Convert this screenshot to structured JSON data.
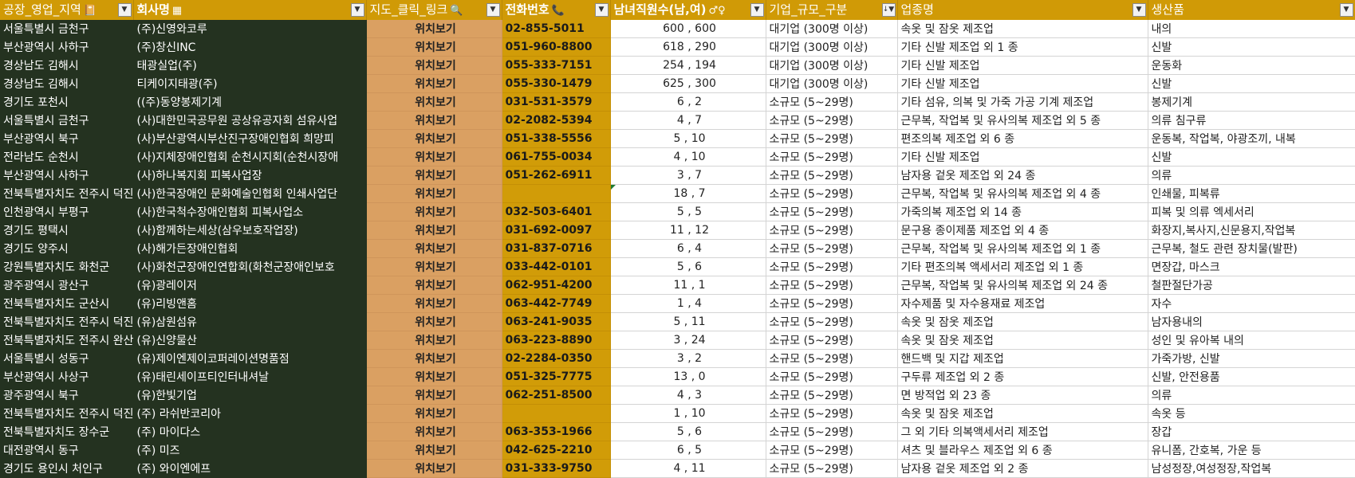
{
  "headers": [
    {
      "label": "공장_영업_지역",
      "icon": "📔",
      "icon_name": "notebook-icon",
      "bold": false
    },
    {
      "label": "회사명",
      "icon": "▦",
      "icon_name": "building-icon",
      "bold": true
    },
    {
      "label": "지도_클릭_링크",
      "icon": "🔍",
      "icon_name": "search-icon",
      "bold": false
    },
    {
      "label": "전화번호",
      "icon": "📞",
      "icon_name": "phone-icon",
      "bold": true
    },
    {
      "label": "남녀직원수(남,여)",
      "icon": "♂♀",
      "icon_name": "gender-icon",
      "bold": true
    },
    {
      "label": "기업_규모_구분",
      "icon": "",
      "icon_name": "",
      "bold": false
    },
    {
      "label": "업종명",
      "icon": "",
      "icon_name": "",
      "bold": false
    },
    {
      "label": "생산품",
      "icon": "",
      "icon_name": "",
      "bold": false
    }
  ],
  "filter_glyph": "▼",
  "sorted_filter_glyph": "↓▼",
  "rows": [
    {
      "region": "서울특별시 금천구",
      "company": "(주)신영와코루",
      "map": "위치보기",
      "phone": "02-855-5011",
      "staff": "600 , 600",
      "scale": "대기업 (300명 이상)",
      "industry": "속옷 및 잠옷 제조업",
      "products": "내의"
    },
    {
      "region": "부산광역시 사하구",
      "company": "(주)창신INC",
      "map": "위치보기",
      "phone": "051-960-8800",
      "staff": "618 , 290",
      "scale": "대기업 (300명 이상)",
      "industry": "기타 신발 제조업 외 1 종",
      "products": "신발"
    },
    {
      "region": "경상남도 김해시",
      "company": "태광실업(주)",
      "map": "위치보기",
      "phone": "055-333-7151",
      "staff": "254 , 194",
      "scale": "대기업 (300명 이상)",
      "industry": "기타 신발 제조업",
      "products": "운동화"
    },
    {
      "region": "경상남도 김해시",
      "company": "티케이지태광(주)",
      "map": "위치보기",
      "phone": "055-330-1479",
      "staff": "625 , 300",
      "scale": "대기업 (300명 이상)",
      "industry": "기타 신발 제조업",
      "products": "신발"
    },
    {
      "region": "경기도 포천시",
      "company": "((주)동양봉제기계",
      "map": "위치보기",
      "phone": "031-531-3579",
      "staff": "6 , 2",
      "scale": "소규모 (5~29명)",
      "industry": "기타 섬유, 의복 및 가죽 가공 기계 제조업",
      "products": "봉제기계"
    },
    {
      "region": "서울특별시 금천구",
      "company": "(사)대한민국공무원 공상유공자회 섬유사업",
      "map": "위치보기",
      "phone": "02-2082-5394",
      "staff": "4 , 7",
      "scale": "소규모 (5~29명)",
      "industry": "근무복, 작업복 및 유사의복 제조업 외 5 종",
      "products": "의류 침구류"
    },
    {
      "region": "부산광역시 북구",
      "company": "(사)부산광역시부산진구장애인협회 희망피",
      "map": "위치보기",
      "phone": "051-338-5556",
      "staff": "5 , 10",
      "scale": "소규모 (5~29명)",
      "industry": "편조의복 제조업 외 6 종",
      "products": "운동복, 작업복, 야광조끼, 내복"
    },
    {
      "region": "전라남도 순천시",
      "company": "(사)지체장애인협회 순천시지회(순천시장애",
      "map": "위치보기",
      "phone": "061-755-0034",
      "staff": "4 , 10",
      "scale": "소규모 (5~29명)",
      "industry": "기타 신발 제조업",
      "products": "신발"
    },
    {
      "region": "부산광역시 사하구",
      "company": "(사)하나복지회 피복사업장",
      "map": "위치보기",
      "phone": "051-262-6911",
      "staff": "3 , 7",
      "scale": "소규모 (5~29명)",
      "industry": "남자용 겉옷 제조업 외 24 종",
      "products": "의류"
    },
    {
      "region": "전북특별자치도 전주시 덕진구",
      "company": "(사)한국장애인 문화예술인협회 인쇄사업단",
      "map": "위치보기",
      "phone": "",
      "staff": "18 , 7",
      "scale": "소규모 (5~29명)",
      "industry": "근무복, 작업복 및 유사의복 제조업 외 4 종",
      "products": "인쇄물, 피복류",
      "mark": true
    },
    {
      "region": "인천광역시 부평구",
      "company": "(사)한국척수장애인협회 피복사업소",
      "map": "위치보기",
      "phone": "032-503-6401",
      "staff": "5 , 5",
      "scale": "소규모 (5~29명)",
      "industry": "가죽의복 제조업 외 14 종",
      "products": "피복 및 의류 엑세서리"
    },
    {
      "region": "경기도 평택시",
      "company": "(사)함께하는세상(삼우보호작업장)",
      "map": "위치보기",
      "phone": "031-692-0097",
      "staff": "11 , 12",
      "scale": "소규모 (5~29명)",
      "industry": "문구용 종이제품 제조업 외 4 종",
      "products": "화장지,복사지,신문용지,작업복"
    },
    {
      "region": "경기도 양주시",
      "company": "(사)해가든장애인협회",
      "map": "위치보기",
      "phone": "031-837-0716",
      "staff": "6 , 4",
      "scale": "소규모 (5~29명)",
      "industry": "근무복, 작업복 및 유사의복 제조업 외 1 종",
      "products": "근무복, 철도 관련 장치물(발판)"
    },
    {
      "region": "강원특별자치도 화천군",
      "company": "(사)화천군장애인연합회(화천군장애인보호",
      "map": "위치보기",
      "phone": "033-442-0101",
      "staff": "5 , 6",
      "scale": "소규모 (5~29명)",
      "industry": "기타 편조의복 액세서리 제조업 외 1 종",
      "products": "면장갑, 마스크"
    },
    {
      "region": "광주광역시 광산구",
      "company": "(유)광레이저",
      "map": "위치보기",
      "phone": "062-951-4200",
      "staff": "11 , 1",
      "scale": "소규모 (5~29명)",
      "industry": "근무복, 작업복 및 유사의복 제조업 외 24 종",
      "products": "철판절단가공"
    },
    {
      "region": "전북특별자치도 군산시",
      "company": "(유)리빙앤홈",
      "map": "위치보기",
      "phone": "063-442-7749",
      "staff": "1 , 4",
      "scale": "소규모 (5~29명)",
      "industry": "자수제품 및 자수용재료 제조업",
      "products": "자수"
    },
    {
      "region": "전북특별자치도 전주시 덕진구",
      "company": "(유)삼원섬유",
      "map": "위치보기",
      "phone": "063-241-9035",
      "staff": "5 , 11",
      "scale": "소규모 (5~29명)",
      "industry": "속옷 및 잠옷 제조업",
      "products": "남자용내의"
    },
    {
      "region": "전북특별자치도 전주시 완산구",
      "company": "(유)신양물산",
      "map": "위치보기",
      "phone": "063-223-8890",
      "staff": "3 , 24",
      "scale": "소규모 (5~29명)",
      "industry": "속옷 및 잠옷 제조업",
      "products": "성인 및 유아복 내의"
    },
    {
      "region": "서울특별시 성동구",
      "company": "(유)제이엔제이코퍼레이션명품점",
      "map": "위치보기",
      "phone": "02-2284-0350",
      "staff": "3 , 2",
      "scale": "소규모 (5~29명)",
      "industry": "핸드백 및 지갑 제조업",
      "products": "가죽가방, 신발"
    },
    {
      "region": "부산광역시 사상구",
      "company": "(유)태린세이프티인터내셔날",
      "map": "위치보기",
      "phone": "051-325-7775",
      "staff": "13 , 0",
      "scale": "소규모 (5~29명)",
      "industry": "구두류 제조업 외 2 종",
      "products": "신발, 안전용품"
    },
    {
      "region": "광주광역시 북구",
      "company": "(유)한빛기업",
      "map": "위치보기",
      "phone": "062-251-8500",
      "staff": "4 , 3",
      "scale": "소규모 (5~29명)",
      "industry": "면 방적업 외 23 종",
      "products": "의류"
    },
    {
      "region": "전북특별자치도 전주시 덕진구",
      "company": "(주) 라쉬반코리아",
      "map": "위치보기",
      "phone": "",
      "staff": "1 , 10",
      "scale": "소규모 (5~29명)",
      "industry": "속옷 및 잠옷 제조업",
      "products": "속옷 등"
    },
    {
      "region": "전북특별자치도 장수군",
      "company": "(주) 마이다스",
      "map": "위치보기",
      "phone": "063-353-1966",
      "staff": "5 , 6",
      "scale": "소규모 (5~29명)",
      "industry": "그 외 기타 의복액세서리 제조업",
      "products": "장갑"
    },
    {
      "region": "대전광역시 동구",
      "company": "(주) 미즈",
      "map": "위치보기",
      "phone": "042-625-2210",
      "staff": "6 , 5",
      "scale": "소규모 (5~29명)",
      "industry": "셔츠 및 블라우스 제조업 외 6 종",
      "products": "유니폼, 간호복, 가운 등"
    },
    {
      "region": "경기도 용인시 처인구",
      "company": "(주) 와이엔에프",
      "map": "위치보기",
      "phone": "031-333-9750",
      "staff": "4 , 11",
      "scale": "소규모 (5~29명)",
      "industry": "남자용 겉옷 제조업 외 2 종",
      "products": "남성정장,여성정장,작업복"
    }
  ]
}
